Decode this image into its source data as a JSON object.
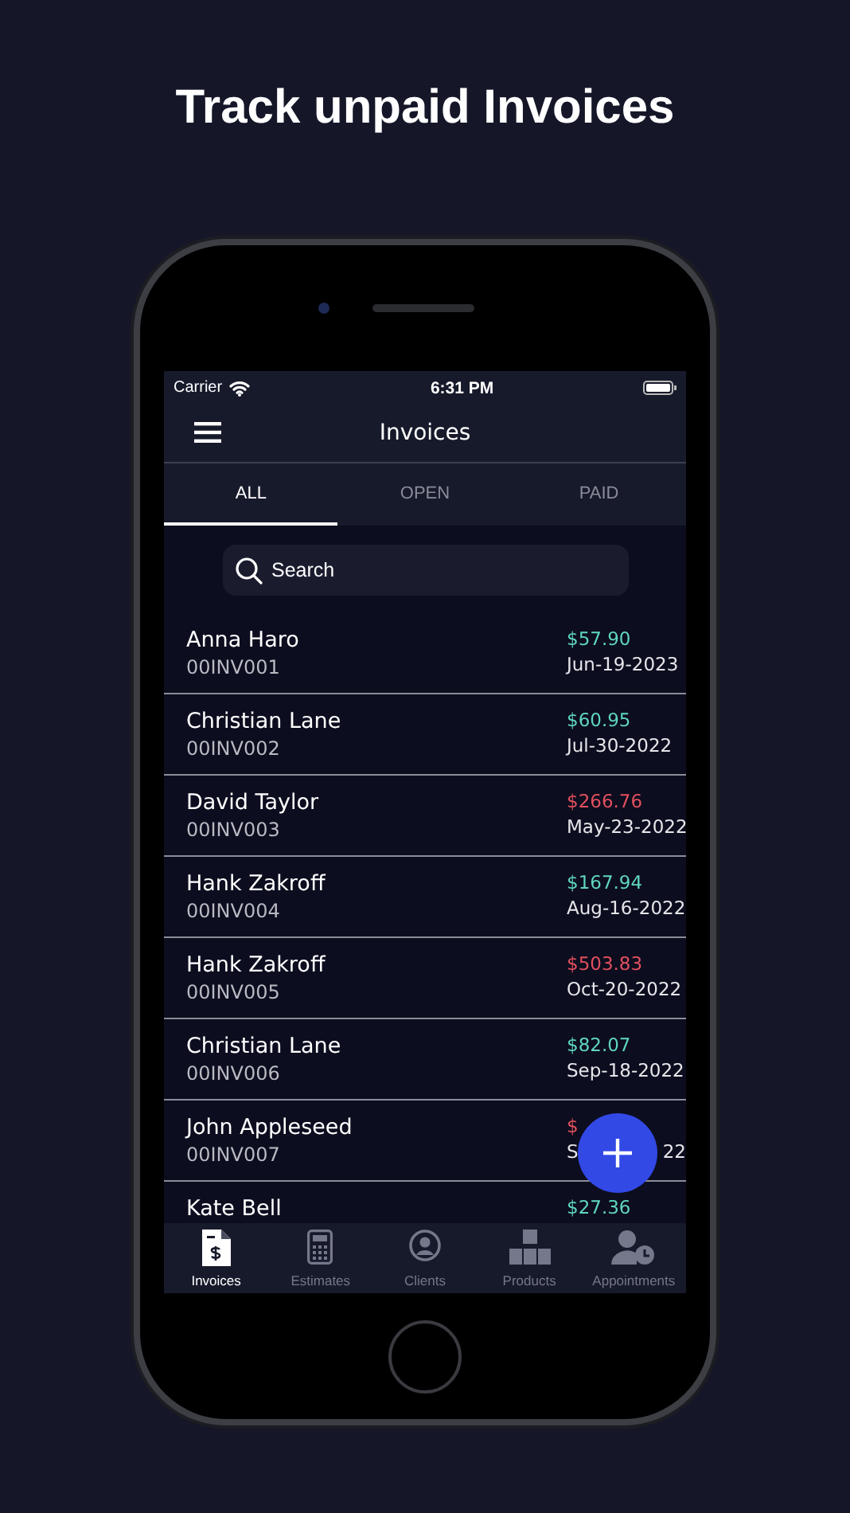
{
  "headline": "Track unpaid Invoices",
  "status_bar": {
    "carrier": "Carrier",
    "time": "6:31 PM"
  },
  "nav": {
    "title": "Invoices"
  },
  "tabs": [
    {
      "label": "ALL",
      "selected": true
    },
    {
      "label": "OPEN",
      "selected": false
    },
    {
      "label": "PAID",
      "selected": false
    }
  ],
  "search": {
    "placeholder": "Search"
  },
  "invoices": [
    {
      "name": "Anna Haro",
      "number": "00INV001",
      "amount": "$57.90",
      "paid": true,
      "date": "Jun-19-2023"
    },
    {
      "name": "Christian Lane",
      "number": "00INV002",
      "amount": "$60.95",
      "paid": true,
      "date": "Jul-30-2022"
    },
    {
      "name": "David Taylor",
      "number": "00INV003",
      "amount": "$266.76",
      "paid": false,
      "date": "May-23-2022"
    },
    {
      "name": "Hank Zakroff",
      "number": "00INV004",
      "amount": "$167.94",
      "paid": true,
      "date": "Aug-16-2022"
    },
    {
      "name": "Hank Zakroff",
      "number": "00INV005",
      "amount": "$503.83",
      "paid": false,
      "date": "Oct-20-2022"
    },
    {
      "name": "Christian Lane",
      "number": "00INV006",
      "amount": "$82.07",
      "paid": true,
      "date": "Sep-18-2022"
    },
    {
      "name": "John Appleseed",
      "number": "00INV007",
      "amount": "$",
      "paid": false,
      "date": "S",
      "date_end": "22"
    },
    {
      "name": "Kate Bell",
      "amount": "$27.36",
      "paid": true
    }
  ],
  "bottom_tabs": [
    {
      "label": "Invoices",
      "kind": "invoice",
      "selected": true
    },
    {
      "label": "Estimates",
      "kind": "calculator",
      "selected": false
    },
    {
      "label": "Clients",
      "kind": "person",
      "selected": false
    },
    {
      "label": "Products",
      "kind": "boxes",
      "selected": false
    },
    {
      "label": "Appointments",
      "kind": "appointment",
      "selected": false
    }
  ]
}
